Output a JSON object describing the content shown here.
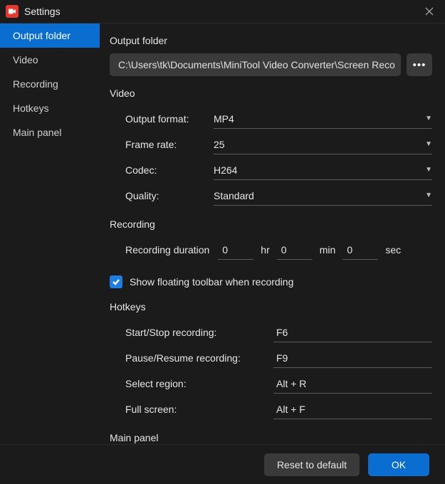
{
  "window": {
    "title": "Settings"
  },
  "sidebar": {
    "items": [
      {
        "label": "Output folder",
        "active": true
      },
      {
        "label": "Video"
      },
      {
        "label": "Recording"
      },
      {
        "label": "Hotkeys"
      },
      {
        "label": "Main panel"
      }
    ]
  },
  "sections": {
    "output_folder": {
      "title": "Output folder",
      "path": "C:\\Users\\tk\\Documents\\MiniTool Video Converter\\Screen Reco",
      "browse_label": "•••"
    },
    "video": {
      "title": "Video",
      "fields": {
        "output_format": {
          "label": "Output format:",
          "value": "MP4"
        },
        "frame_rate": {
          "label": "Frame rate:",
          "value": "25"
        },
        "codec": {
          "label": "Codec:",
          "value": "H264"
        },
        "quality": {
          "label": "Quality:",
          "value": "Standard"
        }
      }
    },
    "recording": {
      "title": "Recording",
      "duration_label": "Recording duration",
      "hr": "0",
      "hr_unit": "hr",
      "min": "0",
      "min_unit": "min",
      "sec": "0",
      "sec_unit": "sec",
      "show_toolbar_checked": true,
      "show_toolbar_label": "Show floating toolbar when recording"
    },
    "hotkeys": {
      "title": "Hotkeys",
      "rows": {
        "start_stop": {
          "label": "Start/Stop recording:",
          "value": "F6"
        },
        "pause_resume": {
          "label": "Pause/Resume recording:",
          "value": "F9"
        },
        "select_region": {
          "label": "Select region:",
          "value": "Alt + R"
        },
        "full_screen": {
          "label": "Full screen:",
          "value": "Alt + F"
        }
      }
    },
    "main_panel": {
      "title": "Main panel"
    }
  },
  "footer": {
    "reset_label": "Reset to default",
    "ok_label": "OK"
  }
}
